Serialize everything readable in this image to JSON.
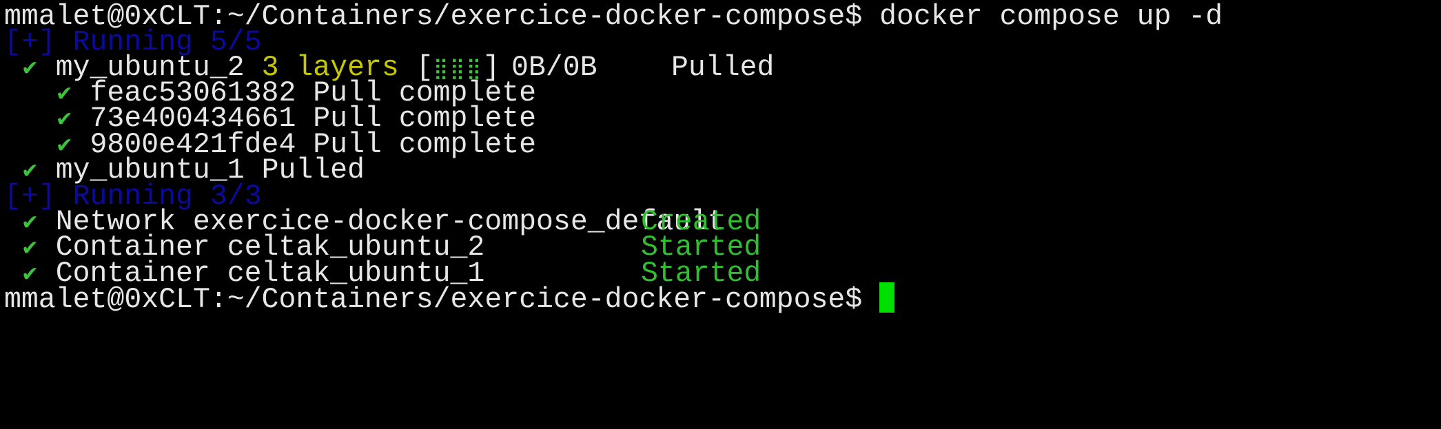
{
  "terminal": {
    "prompt": "mmalet@0xCLT:~/Containers/exercice-docker-compose$",
    "command": "docker compose up -d",
    "sections": [
      {
        "header": "[+] Running 5/5"
      },
      {
        "header": "[+] Running 3/3"
      }
    ],
    "pull": {
      "service2": {
        "name": "my_ubuntu_2",
        "layers": "3 layers",
        "bar_open": "[",
        "bar": "⣿⣿⣿",
        "bar_close": "]",
        "size": "0B/0B",
        "status": "Pulled"
      },
      "layers": [
        {
          "id": "feac53061382",
          "status": "Pull complete"
        },
        {
          "id": "73e400434661",
          "status": "Pull complete"
        },
        {
          "id": "9800e421fde4",
          "status": "Pull complete"
        }
      ],
      "service1": {
        "name": "my_ubuntu_1",
        "status": "Pulled"
      }
    },
    "resources": [
      {
        "label": "Network exercice-docker-compose_default",
        "status": "Created"
      },
      {
        "label": "Container celtak_ubuntu_2",
        "status": "Started"
      },
      {
        "label": "Container celtak_ubuntu_1",
        "status": "Started"
      }
    ],
    "check_glyph": "✔",
    "colors": {
      "background": "#000000",
      "text": "#e6e6e6",
      "header": "#0a0a9e",
      "layers": "#c8c800",
      "success": "#2fbf2f",
      "cursor": "#00e000"
    }
  }
}
